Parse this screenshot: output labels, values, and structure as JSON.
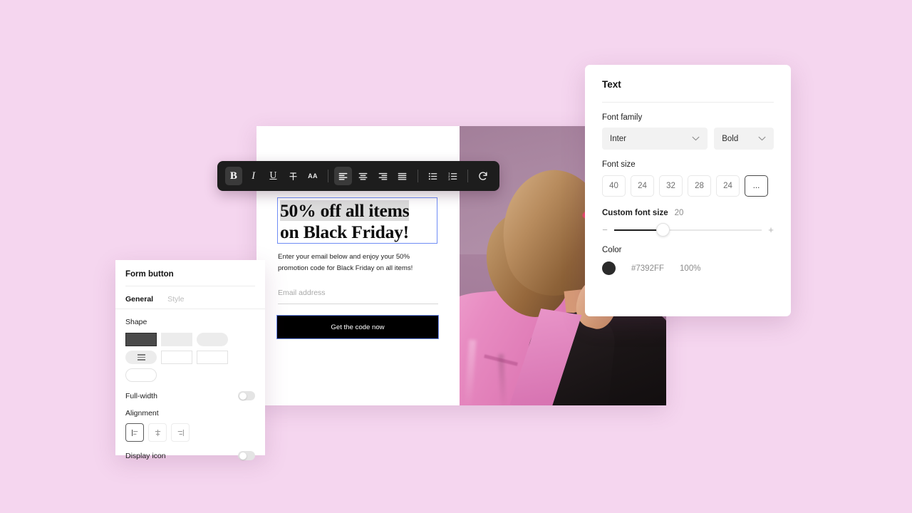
{
  "background": {
    "color": "#f5d6ef"
  },
  "landing": {
    "heading_line1_selected": "50% off all items",
    "heading_line2": "on Black Friday!",
    "body": "Enter your email below and enjoy your 50% promotion code for Black Friday on all items!",
    "email_placeholder": "Email address",
    "cta_label": "Get the code now",
    "photo_alt": "woman-in-pink-blazer-photo"
  },
  "toolbar": {
    "bold": "B",
    "italic": "I",
    "underline": "U",
    "strikethrough": "strikethrough-icon",
    "text_case": "AA",
    "align_left": "align-left-icon",
    "align_center": "align-center-icon",
    "align_right": "align-right-icon",
    "align_justify": "align-justify-icon",
    "bullet_list": "bullet-list-icon",
    "numbered_list": "numbered-list-icon",
    "redo": "redo-icon",
    "active": [
      "bold",
      "align_left"
    ]
  },
  "form_panel": {
    "title": "Form button",
    "tabs": [
      {
        "label": "General",
        "active": true
      },
      {
        "label": "Style",
        "active": false
      }
    ],
    "shape": {
      "label": "Shape",
      "options": [
        {
          "name": "rect-filled-selected",
          "selected": true
        },
        {
          "name": "rect-filled",
          "selected": false
        },
        {
          "name": "pill-filled",
          "selected": false
        },
        {
          "name": "pill-icon",
          "selected": false
        },
        {
          "name": "rect-outline",
          "selected": false
        },
        {
          "name": "rect-outline-2",
          "selected": false
        },
        {
          "name": "pill-outline",
          "selected": false
        }
      ]
    },
    "full_width": {
      "label": "Full-width",
      "value": "off"
    },
    "alignment": {
      "label": "Alignment",
      "options": [
        {
          "name": "align-left",
          "selected": true
        },
        {
          "name": "align-center",
          "selected": false
        },
        {
          "name": "align-right",
          "selected": false
        }
      ]
    },
    "display_icon": {
      "label": "Display icon",
      "value": "off"
    }
  },
  "text_panel": {
    "title": "Text",
    "font_family": {
      "label": "Font family",
      "family_value": "Inter",
      "weight_value": "Bold"
    },
    "font_size": {
      "label": "Font size",
      "options": [
        "40",
        "24",
        "32",
        "28",
        "24"
      ],
      "more_label": "...",
      "selected": "more"
    },
    "custom_font_size": {
      "label": "Custom font size",
      "value": "20",
      "minus": "−",
      "plus": "+",
      "percent_position": 33
    },
    "color": {
      "label": "Color",
      "swatch": "#2b2b2b",
      "hex": "#7392FF",
      "opacity": "100%"
    }
  }
}
